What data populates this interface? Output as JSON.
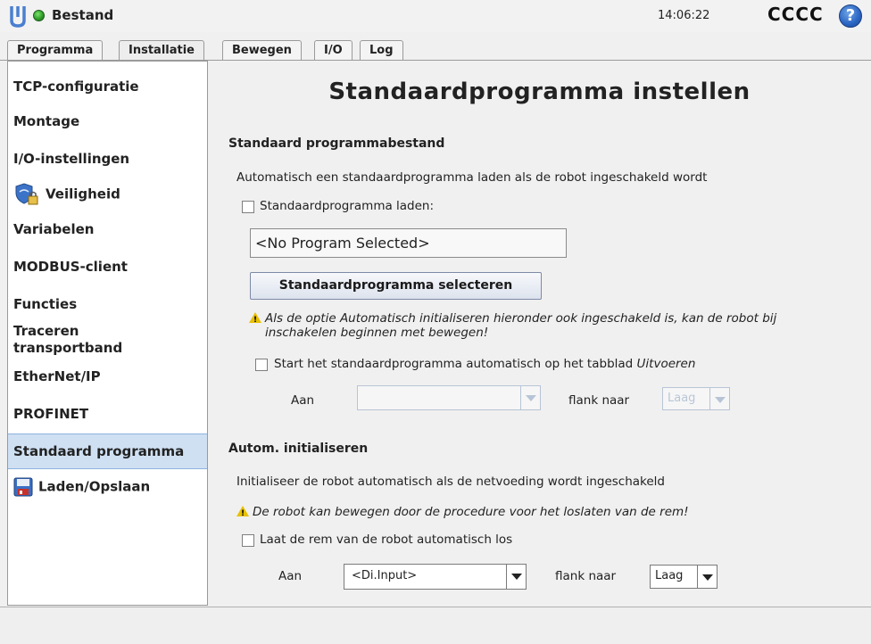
{
  "header": {
    "logo_icon": "universal-robots-logo",
    "status_icon": "status-green-icon",
    "status_color": "#2f9e2a",
    "title": "Bestand",
    "time": "14:06:22",
    "robot_name": "CCCC",
    "help_icon": "help-icon",
    "help_label": "?"
  },
  "tabs": [
    {
      "label": "Programma"
    },
    {
      "label": "Installatie"
    },
    {
      "label": "Bewegen"
    },
    {
      "label": "I/O"
    },
    {
      "label": "Log"
    }
  ],
  "sidebar": {
    "items": [
      {
        "label": "TCP-configuratie"
      },
      {
        "label": "Montage"
      },
      {
        "label": "I/O-instellingen"
      },
      {
        "label": "Veiligheid",
        "icon": "shield-lock-icon"
      },
      {
        "label": "Variabelen"
      },
      {
        "label": "MODBUS-client"
      },
      {
        "label": "Functies"
      },
      {
        "label": "Traceren transportband"
      },
      {
        "label": "EtherNet/IP"
      },
      {
        "label": "PROFINET"
      },
      {
        "label": "Standaard programma",
        "selected": true
      },
      {
        "label": "Laden/Opslaan",
        "icon": "floppy-disk-icon"
      }
    ],
    "selected_color": "#cfe0f3"
  },
  "main": {
    "title": "Standaardprogramma instellen",
    "default_file": {
      "heading": "Standaard programmabestand",
      "description": "Automatisch een standaardprogramma laden als de robot ingeschakeld wordt",
      "load_checkbox_label": "Standaardprogramma laden:",
      "load_checkbox_checked": false,
      "selected_program": "<No Program Selected>",
      "select_button": "Standaardprogramma selecteren",
      "warning_prefix": "Als de optie Automatisch initialiseren hieronder ook ingeschakeld is, kan de robot bij",
      "warning_suffix": "inschakelen beginnen met bewegen!",
      "autostart_label": "Start het standaardprogramma automatisch op het tabblad ",
      "autostart_tab": "Uitvoeren",
      "autostart_checked": false,
      "on_label": "Aan",
      "on_value": "",
      "edge_label": "flank naar",
      "edge_value": "Laag"
    },
    "auto_init": {
      "heading": "Autom. initialiseren",
      "description": "Initialiseer de robot automatisch als de netvoeding wordt ingeschakeld",
      "warning": "De robot kan bewegen door de procedure voor het loslaten van de rem!",
      "release_label": "Laat de rem van de robot automatisch los",
      "release_checked": false,
      "on_label": "Aan",
      "on_value": "<Di.Input>",
      "edge_label": "flank naar",
      "edge_value": "Laag"
    }
  }
}
